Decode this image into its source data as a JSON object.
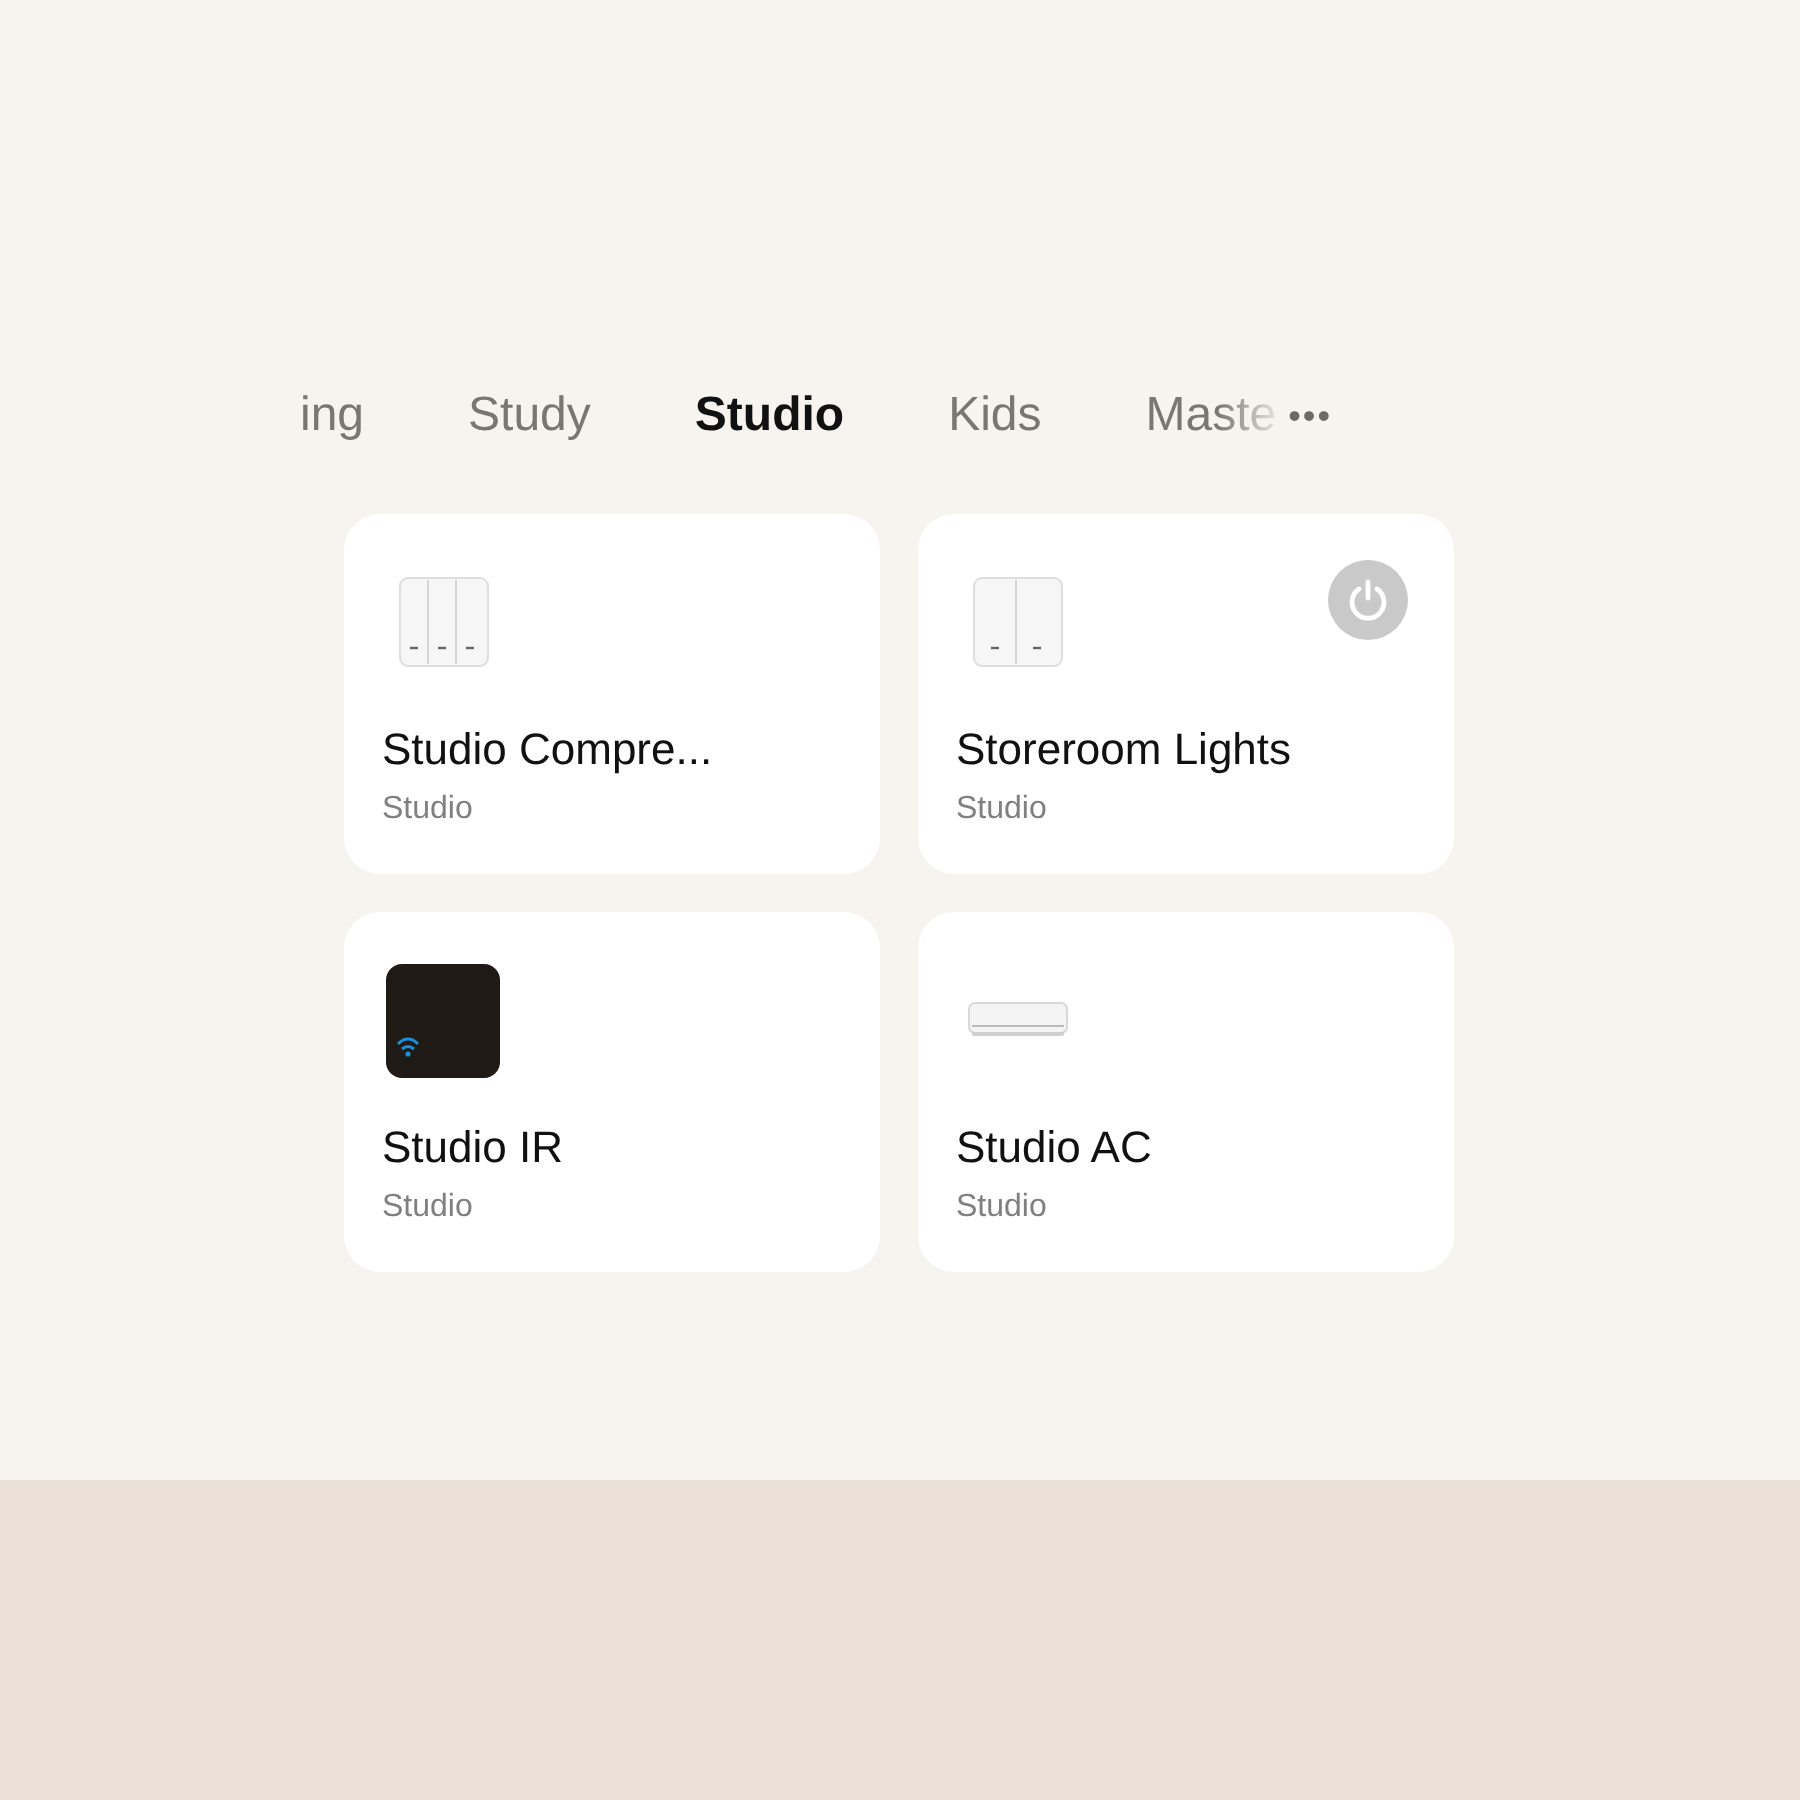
{
  "tabs": [
    {
      "label": "ing",
      "selected": false,
      "faded": false
    },
    {
      "label": "Study",
      "selected": false,
      "faded": false
    },
    {
      "label": "Studio",
      "selected": true,
      "faded": false
    },
    {
      "label": "Kids",
      "selected": false,
      "faded": false
    },
    {
      "label": "Maste",
      "selected": false,
      "faded": true
    }
  ],
  "more_button": "•••",
  "devices": [
    {
      "name": "Studio Compre...",
      "room": "Studio",
      "kind": "switch3",
      "power_button": false
    },
    {
      "name": "Storeroom Lights",
      "room": "Studio",
      "kind": "switch2",
      "power_button": true
    },
    {
      "name": "Studio IR",
      "room": "Studio",
      "kind": "ir",
      "power_button": false
    },
    {
      "name": "Studio AC",
      "room": "Studio",
      "kind": "ac",
      "power_button": false
    }
  ]
}
